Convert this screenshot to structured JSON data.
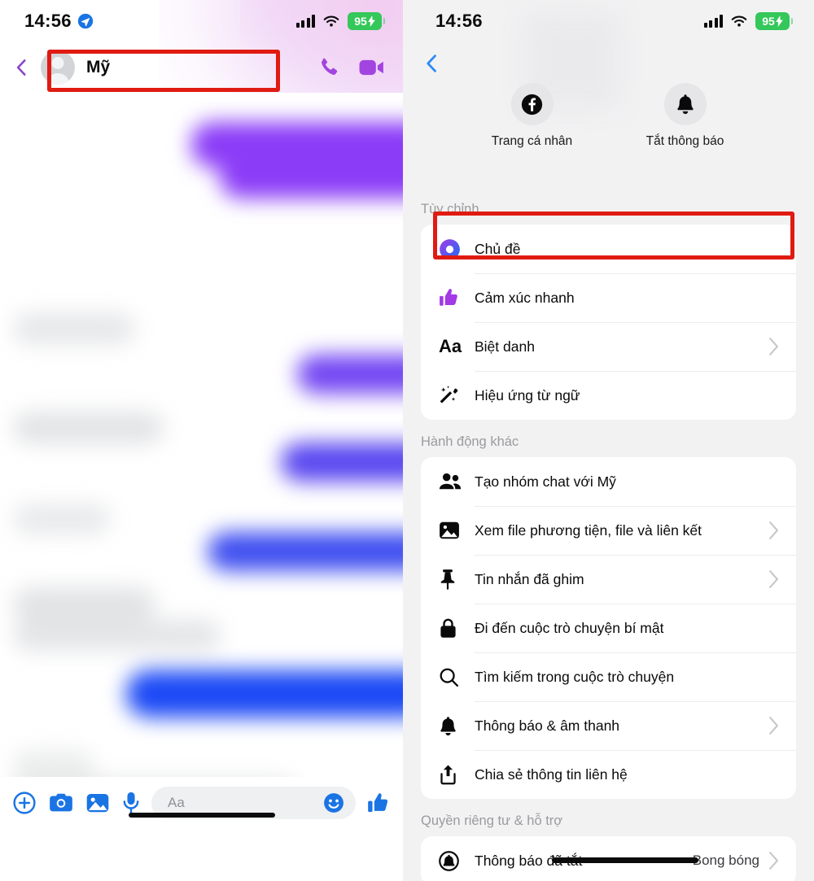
{
  "left": {
    "status": {
      "time": "14:56",
      "location_icon": "location-arrow-icon",
      "signal_icon": "cellular-signal-icon",
      "wifi_icon": "wifi-icon",
      "battery_level": "95",
      "battery_charging": true
    },
    "header": {
      "back_icon": "back-chevron-icon",
      "avatar_icon": "avatar-placeholder-icon",
      "contact_name": "Mỹ",
      "call_icon": "phone-call-icon",
      "video_icon": "video-call-icon"
    },
    "composer": {
      "plus_icon": "plus-circle-icon",
      "camera_icon": "camera-icon",
      "gallery_icon": "photo-gallery-icon",
      "mic_icon": "microphone-icon",
      "placeholder": "Aa",
      "emoji_icon": "emoji-smiley-icon",
      "like_icon": "thumbs-up-icon"
    },
    "thread_note": "blurred-message-bubbles"
  },
  "right": {
    "status": {
      "time": "14:56",
      "signal_icon": "cellular-signal-icon",
      "wifi_icon": "wifi-icon",
      "battery_level": "95",
      "battery_charging": true
    },
    "back_icon": "back-chevron-icon",
    "quick_actions": [
      {
        "icon": "facebook-icon",
        "label": "Trang cá nhân"
      },
      {
        "icon": "bell-icon",
        "label": "Tắt thông báo"
      }
    ],
    "sections": [
      {
        "title": "Tùy chỉnh",
        "rows": [
          {
            "icon": "theme-color-ring-icon",
            "label": "Chủ đề",
            "chevron": false,
            "highlighted": true
          },
          {
            "icon": "thumbs-up-purple-icon",
            "label": "Cảm xúc nhanh",
            "chevron": false
          },
          {
            "icon": "aa-text-icon",
            "label": "Biệt danh",
            "chevron": true
          },
          {
            "icon": "magic-wand-sparkles-icon",
            "label": "Hiệu ứng từ ngữ",
            "chevron": false
          }
        ]
      },
      {
        "title": "Hành động khác",
        "rows": [
          {
            "icon": "people-group-icon",
            "label": "Tạo nhóm chat với Mỹ",
            "chevron": false
          },
          {
            "icon": "media-image-icon",
            "label": "Xem file phương tiện, file và liên kết",
            "chevron": true
          },
          {
            "icon": "pin-icon",
            "label": "Tin nhắn đã ghim",
            "chevron": true
          },
          {
            "icon": "lock-icon",
            "label": "Đi đến cuộc trò chuyện bí mật",
            "chevron": false
          },
          {
            "icon": "search-icon",
            "label": "Tìm kiếm trong cuộc trò chuyện",
            "chevron": false
          },
          {
            "icon": "bell-icon",
            "label": "Thông báo & âm thanh",
            "chevron": true
          },
          {
            "icon": "share-icon",
            "label": "Chia sẻ thông tin liên hệ",
            "chevron": false
          }
        ]
      },
      {
        "title": "Quyền riêng tư & hỗ trợ",
        "rows": [
          {
            "icon": "bell-off-icon",
            "label": "Thông báo đã tắt",
            "value": "Bong bóng",
            "chevron": true
          }
        ]
      }
    ]
  },
  "annotations": {
    "highlight_color": "#e01b12",
    "highlight_targets": [
      "chat-header-contact",
      "row-chu-de"
    ]
  },
  "colors": {
    "accent_blue": "#1b74e4",
    "accent_purple": "#9333ea",
    "battery_green": "#34c759",
    "panel_bg": "#f2f2f3",
    "card_bg": "#ffffff",
    "section_title": "#9b9b9f"
  }
}
